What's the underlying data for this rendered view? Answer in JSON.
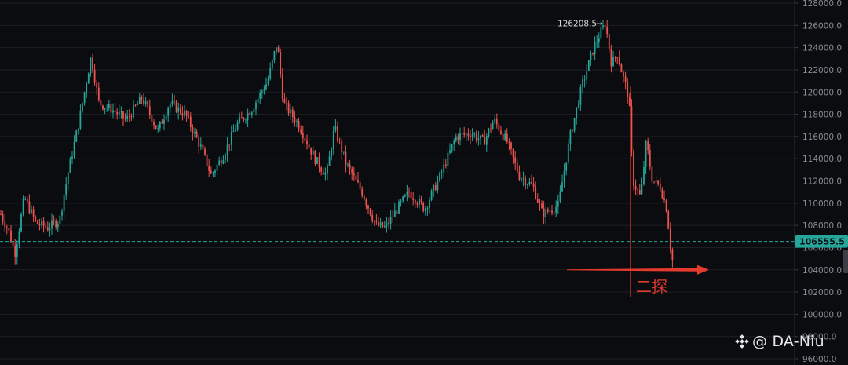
{
  "chart_data": {
    "type": "candlestick",
    "ylim": [
      96000,
      128000
    ],
    "y_ticks": [
      "96000.0",
      "98000.0",
      "100000.0",
      "102000.0",
      "104000.0",
      "106000.0",
      "108000.0",
      "110000.0",
      "112000.0",
      "114000.0",
      "116000.0",
      "118000.0",
      "120000.0",
      "122000.0",
      "124000.0",
      "126000.0",
      "128000.0"
    ],
    "current_price": "106555.5",
    "current_price_value": 106555.5,
    "peak_label": "126208.5",
    "peak_value": 126208.5,
    "annotation": {
      "text": "二探",
      "arrow_price": 104000,
      "drop_line_price_low": 101500
    },
    "colors": {
      "up": "#26a69a",
      "down": "#ef5350",
      "grid": "#1c1f25",
      "annotation": "#e53a2e",
      "price_line": "#26a69a"
    },
    "anchors": [
      [
        0,
        109000
      ],
      [
        10,
        107500
      ],
      [
        18,
        105500
      ],
      [
        30,
        110500
      ],
      [
        45,
        108200
      ],
      [
        60,
        107800
      ],
      [
        75,
        108500
      ],
      [
        85,
        112500
      ],
      [
        100,
        117500
      ],
      [
        115,
        123200
      ],
      [
        125,
        119000
      ],
      [
        140,
        118500
      ],
      [
        160,
        117500
      ],
      [
        180,
        119500
      ],
      [
        200,
        116500
      ],
      [
        215,
        119000
      ],
      [
        235,
        118000
      ],
      [
        255,
        115000
      ],
      [
        268,
        112500
      ],
      [
        285,
        114500
      ],
      [
        300,
        117000
      ],
      [
        320,
        118500
      ],
      [
        340,
        121000
      ],
      [
        352,
        124500
      ],
      [
        360,
        119000
      ],
      [
        380,
        117000
      ],
      [
        400,
        114000
      ],
      [
        415,
        112500
      ],
      [
        425,
        116800
      ],
      [
        440,
        113500
      ],
      [
        460,
        111000
      ],
      [
        478,
        108000
      ],
      [
        490,
        107800
      ],
      [
        505,
        109500
      ],
      [
        520,
        111000
      ],
      [
        540,
        109500
      ],
      [
        560,
        112500
      ],
      [
        580,
        116000
      ],
      [
        600,
        116300
      ],
      [
        615,
        115500
      ],
      [
        628,
        117500
      ],
      [
        645,
        115500
      ],
      [
        660,
        112500
      ],
      [
        678,
        111500
      ],
      [
        690,
        109000
      ],
      [
        710,
        109800
      ],
      [
        725,
        116000
      ],
      [
        740,
        120500
      ],
      [
        755,
        124000
      ],
      [
        765,
        125500
      ],
      [
        770,
        126200
      ],
      [
        778,
        122500
      ],
      [
        785,
        123500
      ],
      [
        792,
        121500
      ],
      [
        800,
        119500
      ],
      [
        805,
        112000
      ],
      [
        815,
        110500
      ],
      [
        822,
        115500
      ],
      [
        830,
        112000
      ],
      [
        840,
        111500
      ],
      [
        848,
        109500
      ],
      [
        855,
        104600
      ],
      [
        858,
        106555
      ]
    ]
  },
  "watermark": {
    "icon": "binance-logo-icon",
    "text": "@ DA-Niu"
  }
}
